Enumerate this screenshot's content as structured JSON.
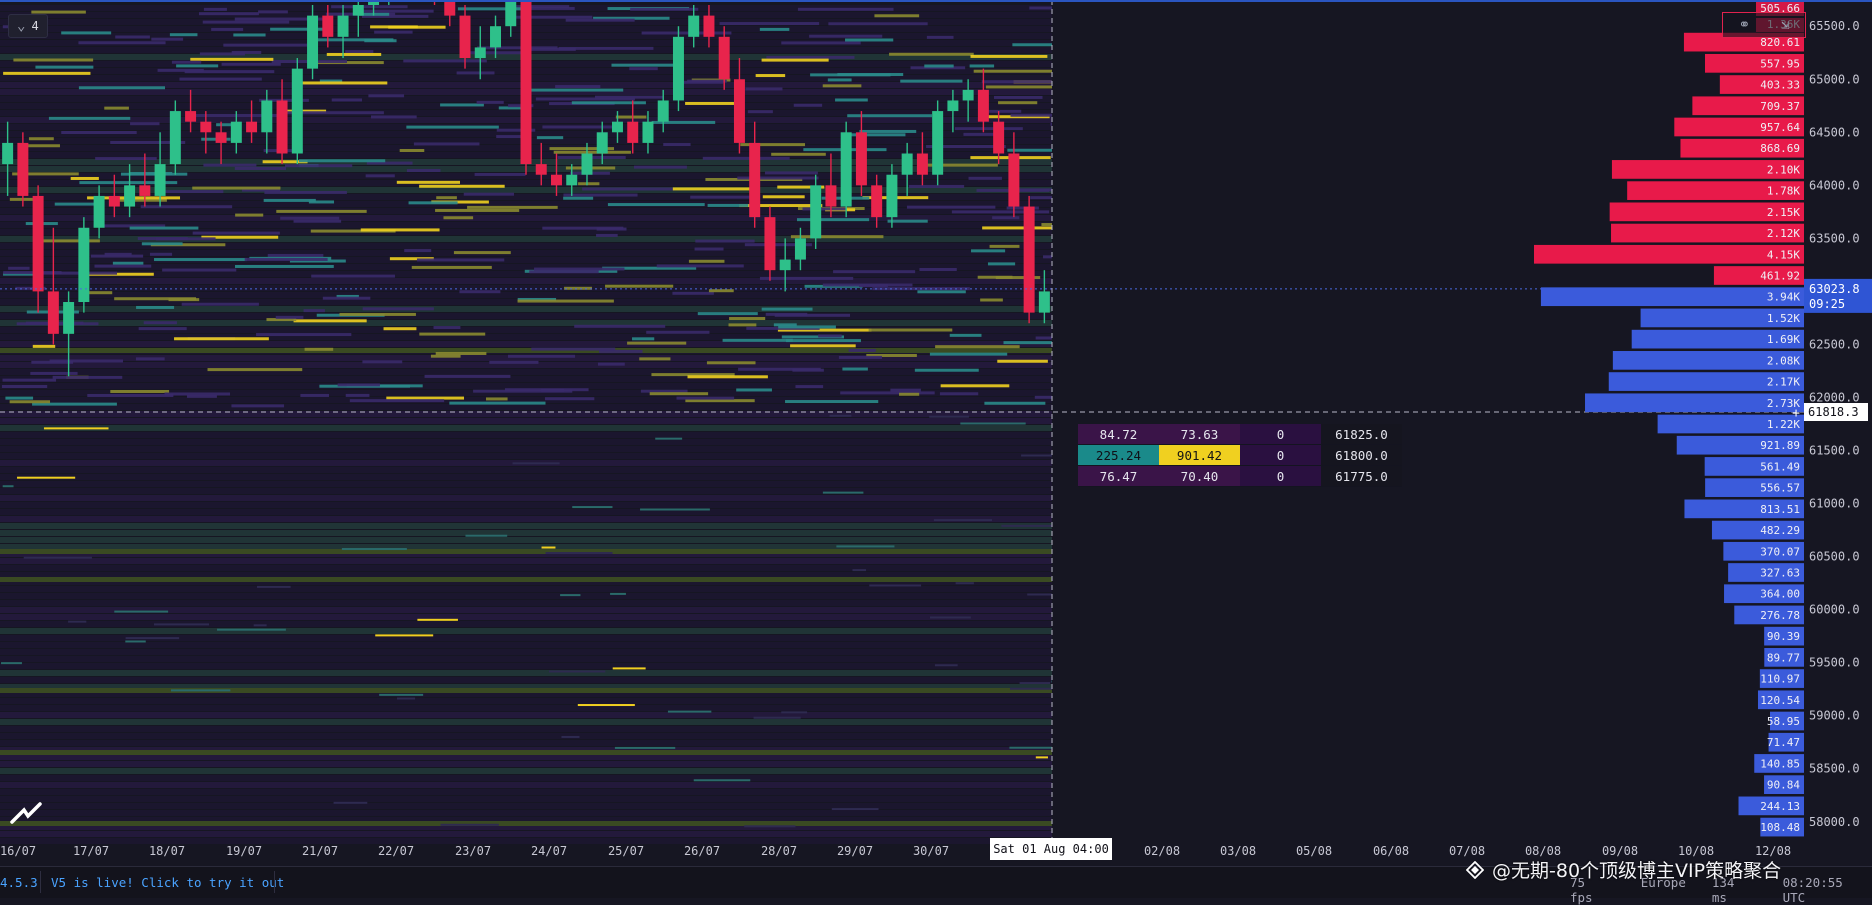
{
  "theme": {
    "background": "#161622",
    "up_color": "#2ec08a",
    "down_color": "#e8244c",
    "bid_bar_color": "#3b5bdb",
    "ask_bar_color": "#e81a4a",
    "heat_low": "#2a1848",
    "heat_mid": "#2a8a8a",
    "heat_high": "#f0d020"
  },
  "toolbar": {
    "interval_value": "4",
    "interval_icon": "chevron-down-icon",
    "link_icon": "link-icon",
    "collapse_icon": "collapse-icon"
  },
  "price_axis": {
    "labels": [
      "65500.0",
      "65000.0",
      "64500.0",
      "64000.0",
      "63500.0",
      "62500.0",
      "62000.0",
      "61500.0",
      "61000.0",
      "60500.0",
      "60000.0",
      "59500.0",
      "59000.0",
      "58500.0",
      "58000.0"
    ],
    "current_price": "63023.8",
    "countdown": "09:25",
    "crosshair_price": "61818.3",
    "crosshair_symbol": "+"
  },
  "time_axis": {
    "labels": [
      "16/07",
      "17/07",
      "18/07",
      "19/07",
      "21/07",
      "22/07",
      "23/07",
      "24/07",
      "25/07",
      "26/07",
      "28/07",
      "29/07",
      "30/07",
      "02/08",
      "03/08",
      "05/08",
      "06/08",
      "07/08",
      "08/08",
      "09/08",
      "10/08",
      "12/08"
    ],
    "crosshair_time": "Sat 01 Aug 04:00"
  },
  "depth_ladder": {
    "ask_top_labels": [
      "505.66",
      "1.36K"
    ],
    "asks": [
      {
        "label": "820.61",
        "price": 65350,
        "size": 820.61
      },
      {
        "label": "557.95",
        "price": 65150,
        "size": 557.95
      },
      {
        "label": "403.33",
        "price": 64950,
        "size": 403.33
      },
      {
        "label": "709.37",
        "price": 64750,
        "size": 709.37
      },
      {
        "label": "957.64",
        "price": 64550,
        "size": 957.64
      },
      {
        "label": "868.69",
        "price": 64350,
        "size": 868.69
      },
      {
        "label": "2.10K",
        "price": 64150,
        "size": 2100
      },
      {
        "label": "1.78K",
        "price": 63950,
        "size": 1780
      },
      {
        "label": "2.15K",
        "price": 63750,
        "size": 2150
      },
      {
        "label": "2.12K",
        "price": 63550,
        "size": 2120
      },
      {
        "label": "4.15K",
        "price": 63350,
        "size": 4150
      },
      {
        "label": "461.92",
        "price": 63150,
        "size": 461.92
      }
    ],
    "bids": [
      {
        "label": "3.94K",
        "price": 62950,
        "size": 3940
      },
      {
        "label": "1.52K",
        "price": 62750,
        "size": 1520
      },
      {
        "label": "1.69K",
        "price": 62550,
        "size": 1690
      },
      {
        "label": "2.08K",
        "price": 62350,
        "size": 2080
      },
      {
        "label": "2.17K",
        "price": 62150,
        "size": 2170
      },
      {
        "label": "2.73K",
        "price": 61950,
        "size": 2730
      },
      {
        "label": "1.22K",
        "price": 61750,
        "size": 1220
      },
      {
        "label": "921.89",
        "price": 61550,
        "size": 921.89
      },
      {
        "label": "561.49",
        "price": 61350,
        "size": 561.49
      },
      {
        "label": "556.57",
        "price": 61150,
        "size": 556.57
      },
      {
        "label": "813.51",
        "price": 60950,
        "size": 813.51
      },
      {
        "label": "482.29",
        "price": 60750,
        "size": 482.29
      },
      {
        "label": "370.07",
        "price": 60550,
        "size": 370.07
      },
      {
        "label": "327.63",
        "price": 60350,
        "size": 327.63
      },
      {
        "label": "364.00",
        "price": 60150,
        "size": 364.0
      },
      {
        "label": "276.78",
        "price": 59950,
        "size": 276.78
      },
      {
        "label": "90.39",
        "price": 59750,
        "size": 90.39
      },
      {
        "label": "89.77",
        "price": 59550,
        "size": 89.77
      },
      {
        "label": "110.97",
        "price": 59350,
        "size": 110.97
      },
      {
        "label": "120.54",
        "price": 59150,
        "size": 120.54
      },
      {
        "label": "58.95",
        "price": 58950,
        "size": 58.95
      },
      {
        "label": "71.47",
        "price": 58750,
        "size": 71.47
      },
      {
        "label": "140.85",
        "price": 58550,
        "size": 140.85
      },
      {
        "label": "90.84",
        "price": 58350,
        "size": 90.84
      },
      {
        "label": "244.13",
        "price": 58150,
        "size": 244.13
      },
      {
        "label": "108.48",
        "price": 57950,
        "size": 108.48
      }
    ]
  },
  "tooltip_table": {
    "rows": [
      {
        "bid": "84.72",
        "ask": "73.63",
        "delta": "0",
        "price": "61825.0",
        "highlight": false
      },
      {
        "bid": "225.24",
        "ask": "901.42",
        "delta": "0",
        "price": "61800.0",
        "highlight": true
      },
      {
        "bid": "76.47",
        "ask": "70.40",
        "delta": "0",
        "price": "61775.0",
        "highlight": false
      }
    ]
  },
  "status_bar": {
    "version": "4.5.3",
    "news": "V5 is live! Click to try it out",
    "fps": "75 fps",
    "region": "Europe",
    "latency": "134 ms",
    "clock": "08:20:55 UTC"
  },
  "watermark": {
    "text": "@无期-80个顶级博主VIP策略聚合"
  },
  "chart_data": {
    "type": "candlestick-heatmap",
    "y_range": [
      57800,
      65700
    ],
    "current_price": 63023.8,
    "candles": [
      [
        64200,
        64600,
        63900,
        64400
      ],
      [
        64400,
        64500,
        63800,
        63900
      ],
      [
        63900,
        64000,
        62800,
        63000
      ],
      [
        63000,
        63600,
        62500,
        62600
      ],
      [
        62600,
        63000,
        62200,
        62900
      ],
      [
        62900,
        63700,
        62800,
        63600
      ],
      [
        63600,
        64000,
        63500,
        63900
      ],
      [
        63900,
        64100,
        63700,
        63800
      ],
      [
        63800,
        64200,
        63700,
        64000
      ],
      [
        64000,
        64300,
        63800,
        63900
      ],
      [
        63900,
        64500,
        63800,
        64200
      ],
      [
        64200,
        64800,
        64100,
        64700
      ],
      [
        64700,
        64900,
        64500,
        64600
      ],
      [
        64600,
        64700,
        64300,
        64500
      ],
      [
        64500,
        64600,
        64200,
        64400
      ],
      [
        64400,
        64700,
        64300,
        64600
      ],
      [
        64600,
        64800,
        64400,
        64500
      ],
      [
        64500,
        64900,
        64300,
        64800
      ],
      [
        64800,
        65000,
        64200,
        64300
      ],
      [
        64300,
        65200,
        64200,
        65100
      ],
      [
        65100,
        65700,
        65000,
        65600
      ],
      [
        65600,
        65700,
        65300,
        65400
      ],
      [
        65400,
        65700,
        65200,
        65600
      ],
      [
        65600,
        65800,
        65400,
        65700
      ],
      [
        65700,
        65900,
        65600,
        65800
      ],
      [
        65800,
        66000,
        65700,
        65900
      ],
      [
        65900,
        66100,
        65800,
        66000
      ],
      [
        66000,
        66200,
        65900,
        66100
      ],
      [
        66100,
        66200,
        65700,
        65800
      ],
      [
        65800,
        65900,
        65500,
        65600
      ],
      [
        65600,
        65700,
        65100,
        65200
      ],
      [
        65200,
        65500,
        65000,
        65300
      ],
      [
        65300,
        65600,
        65200,
        65500
      ],
      [
        65500,
        65900,
        65400,
        65800
      ],
      [
        65800,
        66000,
        64100,
        64200
      ],
      [
        64200,
        64400,
        64000,
        64100
      ],
      [
        64100,
        64300,
        63900,
        64000
      ],
      [
        64000,
        64200,
        63900,
        64100
      ],
      [
        64100,
        64400,
        64000,
        64300
      ],
      [
        64300,
        64600,
        64200,
        64500
      ],
      [
        64500,
        64700,
        64400,
        64600
      ],
      [
        64600,
        64800,
        64300,
        64400
      ],
      [
        64400,
        64700,
        64300,
        64600
      ],
      [
        64600,
        64900,
        64500,
        64800
      ],
      [
        64800,
        65500,
        64700,
        65400
      ],
      [
        65400,
        65700,
        65300,
        65600
      ],
      [
        65600,
        65700,
        65300,
        65400
      ],
      [
        65400,
        65500,
        64900,
        65000
      ],
      [
        65000,
        65200,
        64300,
        64400
      ],
      [
        64400,
        64600,
        63600,
        63700
      ],
      [
        63700,
        63800,
        63100,
        63200
      ],
      [
        63200,
        63500,
        63000,
        63300
      ],
      [
        63300,
        63600,
        63200,
        63500
      ],
      [
        63500,
        64100,
        63400,
        64000
      ],
      [
        64000,
        64300,
        63700,
        63800
      ],
      [
        63800,
        64600,
        63700,
        64500
      ],
      [
        64500,
        64700,
        63900,
        64000
      ],
      [
        64000,
        64100,
        63600,
        63700
      ],
      [
        63700,
        64200,
        63600,
        64100
      ],
      [
        64100,
        64400,
        63900,
        64300
      ],
      [
        64300,
        64500,
        64000,
        64100
      ],
      [
        64100,
        64800,
        64000,
        64700
      ],
      [
        64700,
        64900,
        64500,
        64800
      ],
      [
        64800,
        65000,
        64600,
        64900
      ],
      [
        64900,
        65100,
        64500,
        64600
      ],
      [
        64600,
        64700,
        64200,
        64300
      ],
      [
        64300,
        64500,
        63700,
        63800
      ],
      [
        63800,
        63900,
        62700,
        62800
      ],
      [
        62800,
        63200,
        62700,
        63000
      ]
    ]
  }
}
